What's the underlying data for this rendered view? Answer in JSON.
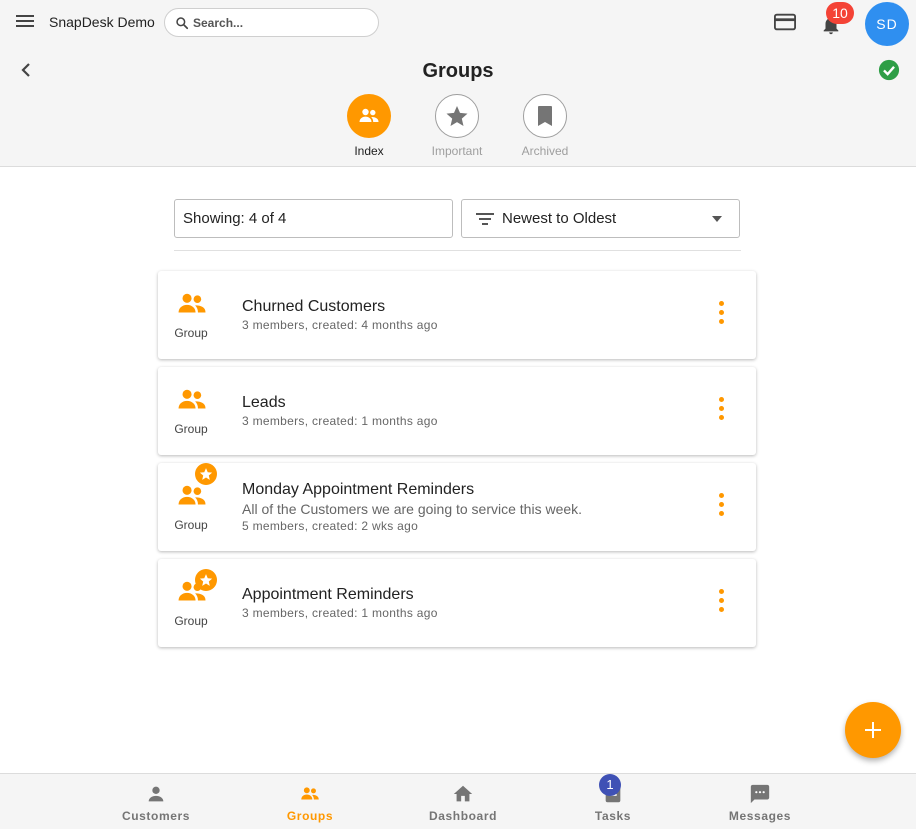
{
  "header": {
    "app_name": "SnapDesk Demo",
    "search_placeholder": "Search...",
    "notification_count": "10",
    "avatar_initials": "SD",
    "page_title": "Groups"
  },
  "view_tabs": [
    {
      "label": "Index",
      "icon": "group-icon",
      "active": true
    },
    {
      "label": "Important",
      "icon": "star-icon",
      "active": false
    },
    {
      "label": "Archived",
      "icon": "bookmark-icon",
      "active": false
    }
  ],
  "filters": {
    "showing": "Showing: 4 of 4",
    "sort": "Newest to Oldest"
  },
  "groups": [
    {
      "type": "Group",
      "name": "Churned Customers",
      "description": "",
      "meta": "3 members, created: 4 months ago",
      "starred": false
    },
    {
      "type": "Group",
      "name": "Leads",
      "description": "",
      "meta": "3 members, created: 1 months ago",
      "starred": false
    },
    {
      "type": "Group",
      "name": "Monday Appointment Reminders",
      "description": "All of the Customers we are going to service this week.",
      "meta": "5 members, created: 2 wks ago",
      "starred": true
    },
    {
      "type": "Group",
      "name": "Appointment Reminders",
      "description": "",
      "meta": "3 members, created: 1 months ago",
      "starred": true
    }
  ],
  "bottom_nav": [
    {
      "label": "Customers",
      "icon": "person-icon",
      "active": false
    },
    {
      "label": "Groups",
      "icon": "group-icon",
      "active": true
    },
    {
      "label": "Dashboard",
      "icon": "home-icon",
      "active": false
    },
    {
      "label": "Tasks",
      "icon": "tasks-icon",
      "active": false,
      "badge": "1"
    },
    {
      "label": "Messages",
      "icon": "message-icon",
      "active": false
    }
  ],
  "colors": {
    "accent": "#ff9800",
    "avatar": "#2f8ff0",
    "badge_red": "#f44336",
    "badge_blue": "#3f51b5",
    "check_green": "#2e9e46"
  }
}
